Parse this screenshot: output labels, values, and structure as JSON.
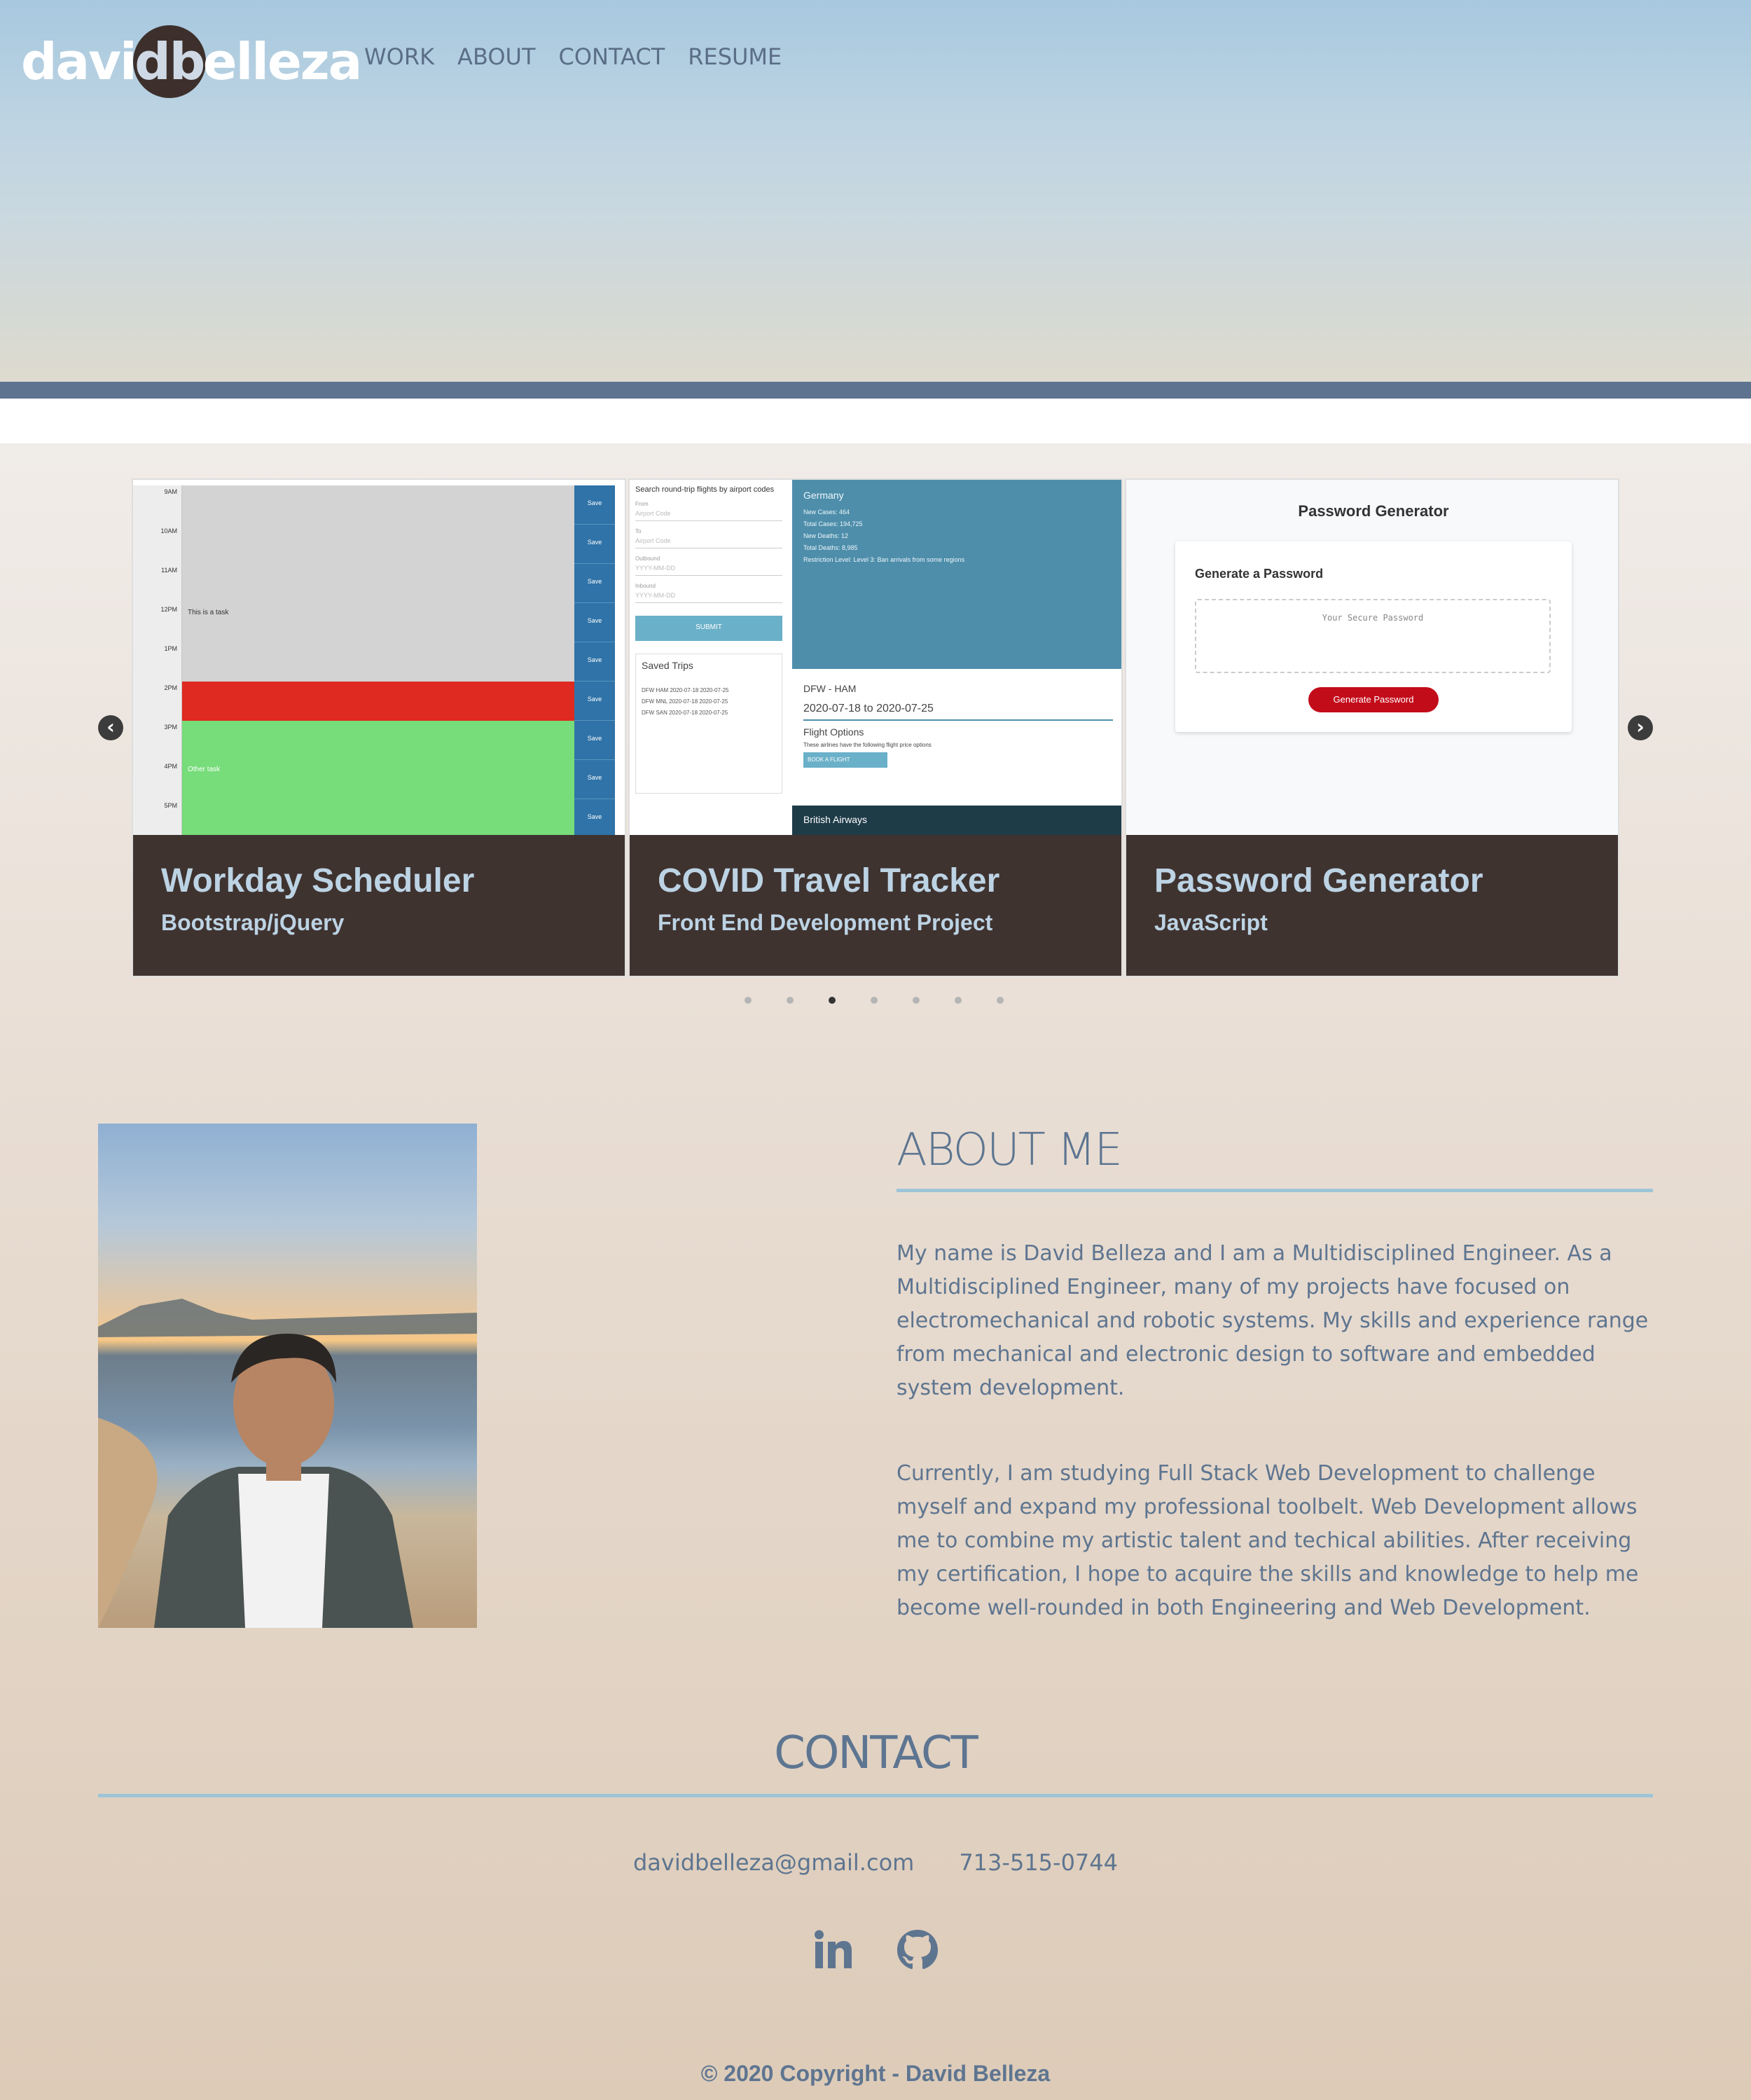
{
  "header": {
    "logo": {
      "left": "davi",
      "mid": "db",
      "right": "elleza"
    },
    "nav": [
      {
        "label": "WORK"
      },
      {
        "label": "ABOUT"
      },
      {
        "label": "CONTACT"
      },
      {
        "label": "RESUME"
      }
    ]
  },
  "carousel": {
    "prev_icon": "chevron-left-icon",
    "next_icon": "chevron-right-icon",
    "cards": [
      {
        "title": "Workday Scheduler",
        "subtitle": "Bootstrap/jQuery"
      },
      {
        "title": "COVID Travel Tracker",
        "subtitle": "Front End Development Project"
      },
      {
        "title": "Password Generator",
        "subtitle": "JavaScript"
      }
    ],
    "dot_count": 7,
    "active_dot": 3,
    "scheduler": {
      "times": [
        "9AM",
        "10AM",
        "11AM",
        "12PM",
        "1PM",
        "2PM",
        "3PM",
        "4PM",
        "5PM"
      ],
      "save": "Save",
      "task_12": "This is a task",
      "task_4": "Other task",
      "colors": {
        "past": "#d3d3d3",
        "present": "#de2a20",
        "future": "#77dc7a"
      }
    },
    "covid": {
      "search_title": "Search round-trip flights by airport codes",
      "from_label": "From",
      "to_label": "To",
      "airport_placeholder": "Airport Code",
      "outbound_label": "Outbound",
      "inbound_label": "Inbound",
      "date_placeholder": "YYYY-MM-DD",
      "submit": "SUBMIT",
      "saved_trips": "Saved Trips",
      "trips": [
        "DFW HAM 2020-07-18 2020-07-25",
        "DFW MNL 2020-07-18 2020-07-25",
        "DFW SAN 2020-07-18 2020-07-25"
      ],
      "country": "Germany",
      "stats": [
        "New Cases: 464",
        "Total Cases: 194,725",
        "New Deaths: 12",
        "Total Deaths: 8,985",
        "Restriction Level: Level 3: Ban arrivals from some regions"
      ],
      "route": "DFW - HAM",
      "dates": "2020-07-18 to 2020-07-25",
      "flight_options": "Flight Options",
      "flight_note": "These airlines have the following flight price options",
      "book": "BOOK A FLIGHT",
      "airline": "British Airways"
    },
    "password": {
      "heading": "Password Generator",
      "card_title": "Generate a Password",
      "placeholder": "Your Secure Password",
      "button": "Generate Password"
    }
  },
  "about": {
    "title": "ABOUT ME",
    "paragraphs": [
      "My name is David Belleza and I am a Multidisciplined Engineer. As a Multidisciplined Engineer, many of my projects have focused on electromechanical and robotic systems. My skills and experience range from mechanical and electronic design to software and embedded system development.",
      "Currently, I am studying Full Stack Web Development to challenge myself and expand my professional toolbelt. Web Development allows me to combine my artistic talent and techical abilities. After receiving my certification, I hope to acquire the skills and knowledge to help me become well-rounded in both Engineering and Web Development."
    ]
  },
  "contact": {
    "title": "CONTACT",
    "email": "davidbelleza@gmail.com",
    "phone": "713-515-0744",
    "socials": [
      {
        "icon": "linkedin-icon"
      },
      {
        "icon": "github-icon"
      }
    ]
  },
  "footer": {
    "copyright": "© 2020 Copyright - David Belleza"
  },
  "colors": {
    "accent": "#9dc5d9",
    "text": "#5e7590",
    "caption_bg": "#3f3330",
    "band": "#5e7390"
  }
}
